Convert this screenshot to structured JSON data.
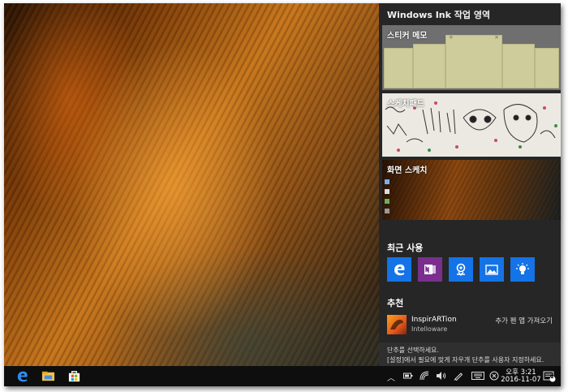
{
  "ink_workspace": {
    "title": "Windows Ink 작업 영역",
    "sticky_notes_label": "스티커 메모",
    "sketchpad_label": "스케치패드",
    "screen_sketch_label": "화면 스케치",
    "recently_used_label": "최근 사용",
    "recent_apps": [
      {
        "name": "edge-icon",
        "color": "#1473e6"
      },
      {
        "name": "onenote-icon",
        "color": "#7a2f8f"
      },
      {
        "name": "maps-icon",
        "color": "#1473e6"
      },
      {
        "name": "photos-icon",
        "color": "#1473e6"
      },
      {
        "name": "tips-icon",
        "color": "#1473e6"
      }
    ],
    "suggested_label": "추천",
    "suggested_app": {
      "name": "InspirARTion",
      "publisher": "Intelloware",
      "action": "추가 펜 앱 가져오기"
    },
    "footer_line1": "단추를 선택하세요.",
    "footer_line2": "[설정]에서 필요에 맞게 자우개 단추를 사용자 지정하세요."
  },
  "taskbar": {
    "apps": [
      "edge-icon",
      "file-explorer-icon",
      "store-icon"
    ],
    "tray": [
      "chevron-up-icon",
      "battery-icon",
      "network-icon",
      "volume-icon",
      "pen-icon",
      "keyboard-icon",
      "close-circle-icon"
    ],
    "time": "오후 3:21",
    "date": "2016-11-07",
    "notification_count": "2"
  }
}
